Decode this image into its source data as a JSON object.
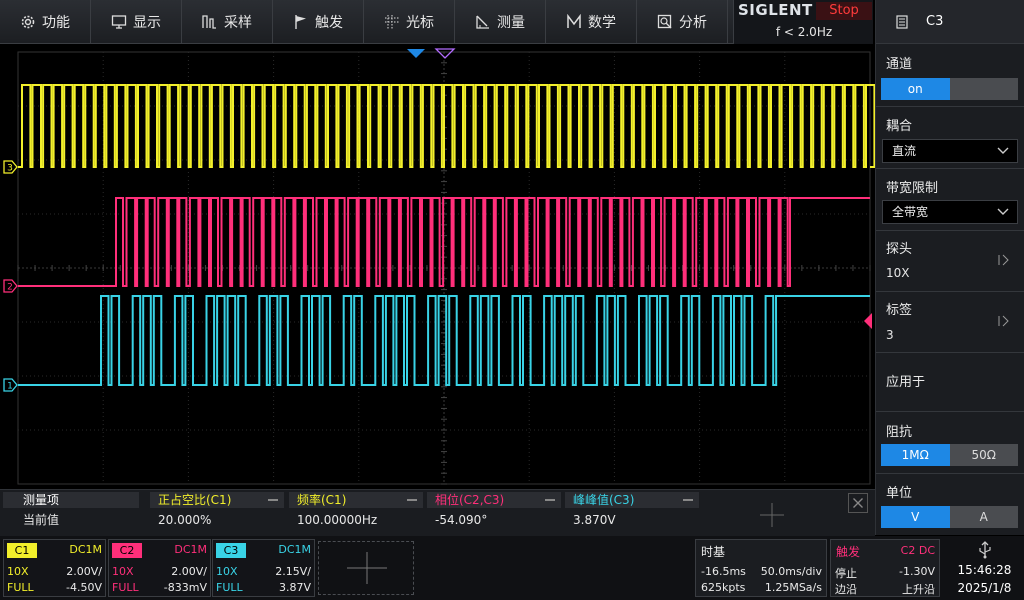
{
  "menu": [
    {
      "label": "功能",
      "icon": "gear-icon"
    },
    {
      "label": "显示",
      "icon": "monitor-icon"
    },
    {
      "label": "采样",
      "icon": "sample-icon"
    },
    {
      "label": "触发",
      "icon": "flag-icon"
    },
    {
      "label": "光标",
      "icon": "crosshair-icon"
    },
    {
      "label": "测量",
      "icon": "ruler-icon"
    },
    {
      "label": "数学",
      "icon": "math-icon"
    },
    {
      "label": "分析",
      "icon": "analysis-icon"
    }
  ],
  "brand": {
    "logo": "SIGLENT",
    "run_state": "Stop",
    "trigger_frequency": "f < 2.0Hz"
  },
  "panel": {
    "title": "C3",
    "channel": {
      "label": "通道",
      "on": "on",
      "off": ""
    },
    "coupling": {
      "label": "耦合",
      "value": "直流"
    },
    "bandwidth": {
      "label": "带宽限制",
      "value": "全带宽"
    },
    "probe": {
      "label": "探头",
      "value": "10X"
    },
    "tag": {
      "label": "标签",
      "value": "3"
    },
    "apply": {
      "label": "应用于"
    },
    "impedance": {
      "label": "阻抗",
      "opt1": "1MΩ",
      "opt2": "50Ω"
    },
    "unit": {
      "label": "单位",
      "opt1": "V",
      "opt2": "A"
    }
  },
  "colors": {
    "c1": "#39d3e6",
    "c2": "#ff2f7a",
    "c3": "#f2ef2b",
    "accent": "#1e88e5",
    "stop": "#ff3b3b"
  },
  "markers": {
    "c1": "1",
    "c2": "2",
    "c3": "3"
  },
  "measurements": {
    "col0": {
      "header": "测量项",
      "value": "当前值"
    },
    "items": [
      {
        "header": "正占空比(C1)",
        "value": "20.000%",
        "color": "#f2ef2b"
      },
      {
        "header": "频率(C1)",
        "value": "100.00000Hz",
        "color": "#f2ef2b"
      },
      {
        "header": "相位(C2,C3)",
        "value": "-54.090°",
        "color": "#ff2f7a"
      },
      {
        "header": "峰峰值(C3)",
        "value": "3.870V",
        "color": "#39d3e6"
      }
    ]
  },
  "channels": [
    {
      "tag": "C1",
      "coupling": "DC1M",
      "probe": "10X",
      "scale": "2.00V/",
      "bw": "FULL",
      "offset": "-4.50V",
      "color": "#f2ef2b"
    },
    {
      "tag": "C2",
      "coupling": "DC1M",
      "probe": "10X",
      "scale": "2.00V/",
      "bw": "FULL",
      "offset": "-833mV",
      "color": "#ff2f7a"
    },
    {
      "tag": "C3",
      "coupling": "DC1M",
      "probe": "10X",
      "scale": "2.15V/",
      "bw": "FULL",
      "offset": "3.87V",
      "color": "#39d3e6"
    }
  ],
  "timebase": {
    "title": "时基",
    "delay": "-16.5ms",
    "scale": "50.0ms/div",
    "points": "625kpts",
    "rate": "1.25MSa/s"
  },
  "trigger": {
    "title": "触发",
    "source": "C2 DC",
    "mode": "停止",
    "level": "-1.30V",
    "type": "边沿",
    "slope": "上升沿"
  },
  "clock": {
    "time": "15:46:28",
    "date": "2025/1/8"
  }
}
